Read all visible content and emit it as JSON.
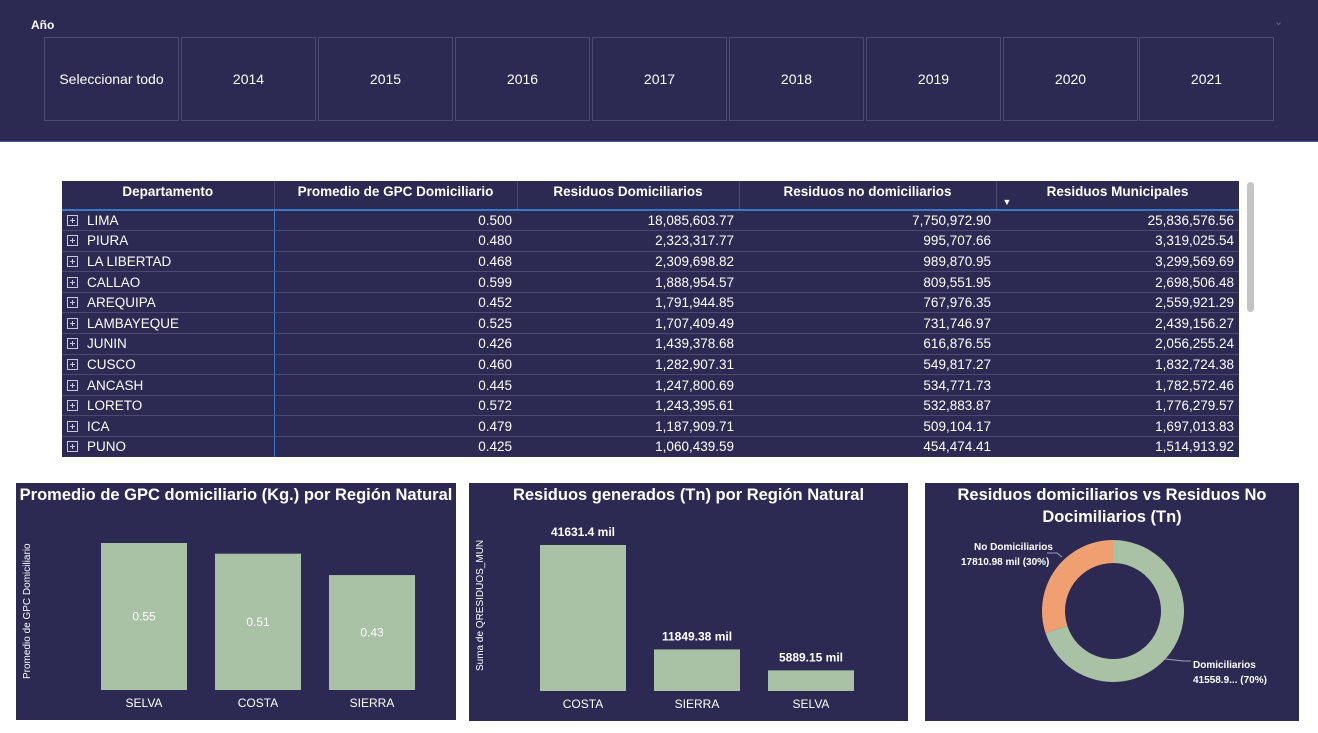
{
  "slicer": {
    "title": "Año",
    "options": [
      "Seleccionar todo",
      "2014",
      "2015",
      "2016",
      "2017",
      "2018",
      "2019",
      "2020",
      "2021"
    ]
  },
  "table": {
    "columns": [
      "Departamento",
      "Promedio de GPC Domiciliario",
      "Residuos Domiciliarios",
      "Residuos no domiciliarios",
      "Residuos Municipales"
    ],
    "rows": [
      [
        "LIMA",
        "0.500",
        "18,085,603.77",
        "7,750,972.90",
        "25,836,576.56"
      ],
      [
        "PIURA",
        "0.480",
        "2,323,317.77",
        "995,707.66",
        "3,319,025.54"
      ],
      [
        "LA LIBERTAD",
        "0.468",
        "2,309,698.82",
        "989,870.95",
        "3,299,569.69"
      ],
      [
        "CALLAO",
        "0.599",
        "1,888,954.57",
        "809,551.95",
        "2,698,506.48"
      ],
      [
        "AREQUIPA",
        "0.452",
        "1,791,944.85",
        "767,976.35",
        "2,559,921.29"
      ],
      [
        "LAMBAYEQUE",
        "0.525",
        "1,707,409.49",
        "731,746.97",
        "2,439,156.27"
      ],
      [
        "JUNIN",
        "0.426",
        "1,439,378.68",
        "616,876.55",
        "2,056,255.24"
      ],
      [
        "CUSCO",
        "0.460",
        "1,282,907.31",
        "549,817.27",
        "1,832,724.38"
      ],
      [
        "ANCASH",
        "0.445",
        "1,247,800.69",
        "534,771.73",
        "1,782,572.46"
      ],
      [
        "LORETO",
        "0.572",
        "1,243,395.61",
        "532,883.87",
        "1,776,279.57"
      ],
      [
        "ICA",
        "0.479",
        "1,187,909.71",
        "509,104.17",
        "1,697,013.83"
      ],
      [
        "PUNO",
        "0.425",
        "1,060,439.59",
        "454,474.41",
        "1,514,913.92"
      ]
    ],
    "sort_icon": "sort-descending-icon",
    "expand_icon": "expand-plus-icon"
  },
  "colors": {
    "panel": "#2c2a52",
    "bar": "#a9c1a5",
    "accent_orange": "#f0a070",
    "header_line": "#3a78c8"
  },
  "chart_data": [
    {
      "type": "bar",
      "title": "Promedio de GPC domiciliario (Kg.) por Región Natural",
      "ylabel": "Promedio de GPC Domiciliario",
      "categories": [
        "SELVA",
        "COSTA",
        "SIERRA"
      ],
      "values": [
        0.55,
        0.51,
        0.43
      ],
      "data_labels": [
        "0.55",
        "0.51",
        "0.43"
      ],
      "ylim": [
        0,
        0.6
      ]
    },
    {
      "type": "bar",
      "title": "Residuos generados (Tn) por Región Natural",
      "ylabel": "Suma de QRESIDUOS_MUN",
      "categories": [
        "COSTA",
        "SIERRA",
        "SELVA"
      ],
      "values": [
        41631.4,
        11849.38,
        5889.15
      ],
      "data_labels": [
        "41631.4 mil",
        "11849.38 mil",
        "5889.15 mil"
      ],
      "ylim": [
        0,
        45000
      ]
    },
    {
      "type": "pie",
      "title": "Residuos domiciliarios vs Residuos No Docimiliarios (Tn)",
      "slices": [
        {
          "name": "Domiciliarios",
          "value": 41558.9,
          "percent": 70,
          "label_line1": "Domiciliarios",
          "label_line2": "41558.9... (70%)"
        },
        {
          "name": "No Domiciliarios",
          "value": 17810.98,
          "percent": 30,
          "label_line1": "No Domiciliarios",
          "label_line2": "17810.98 mil (30%)"
        }
      ]
    }
  ]
}
